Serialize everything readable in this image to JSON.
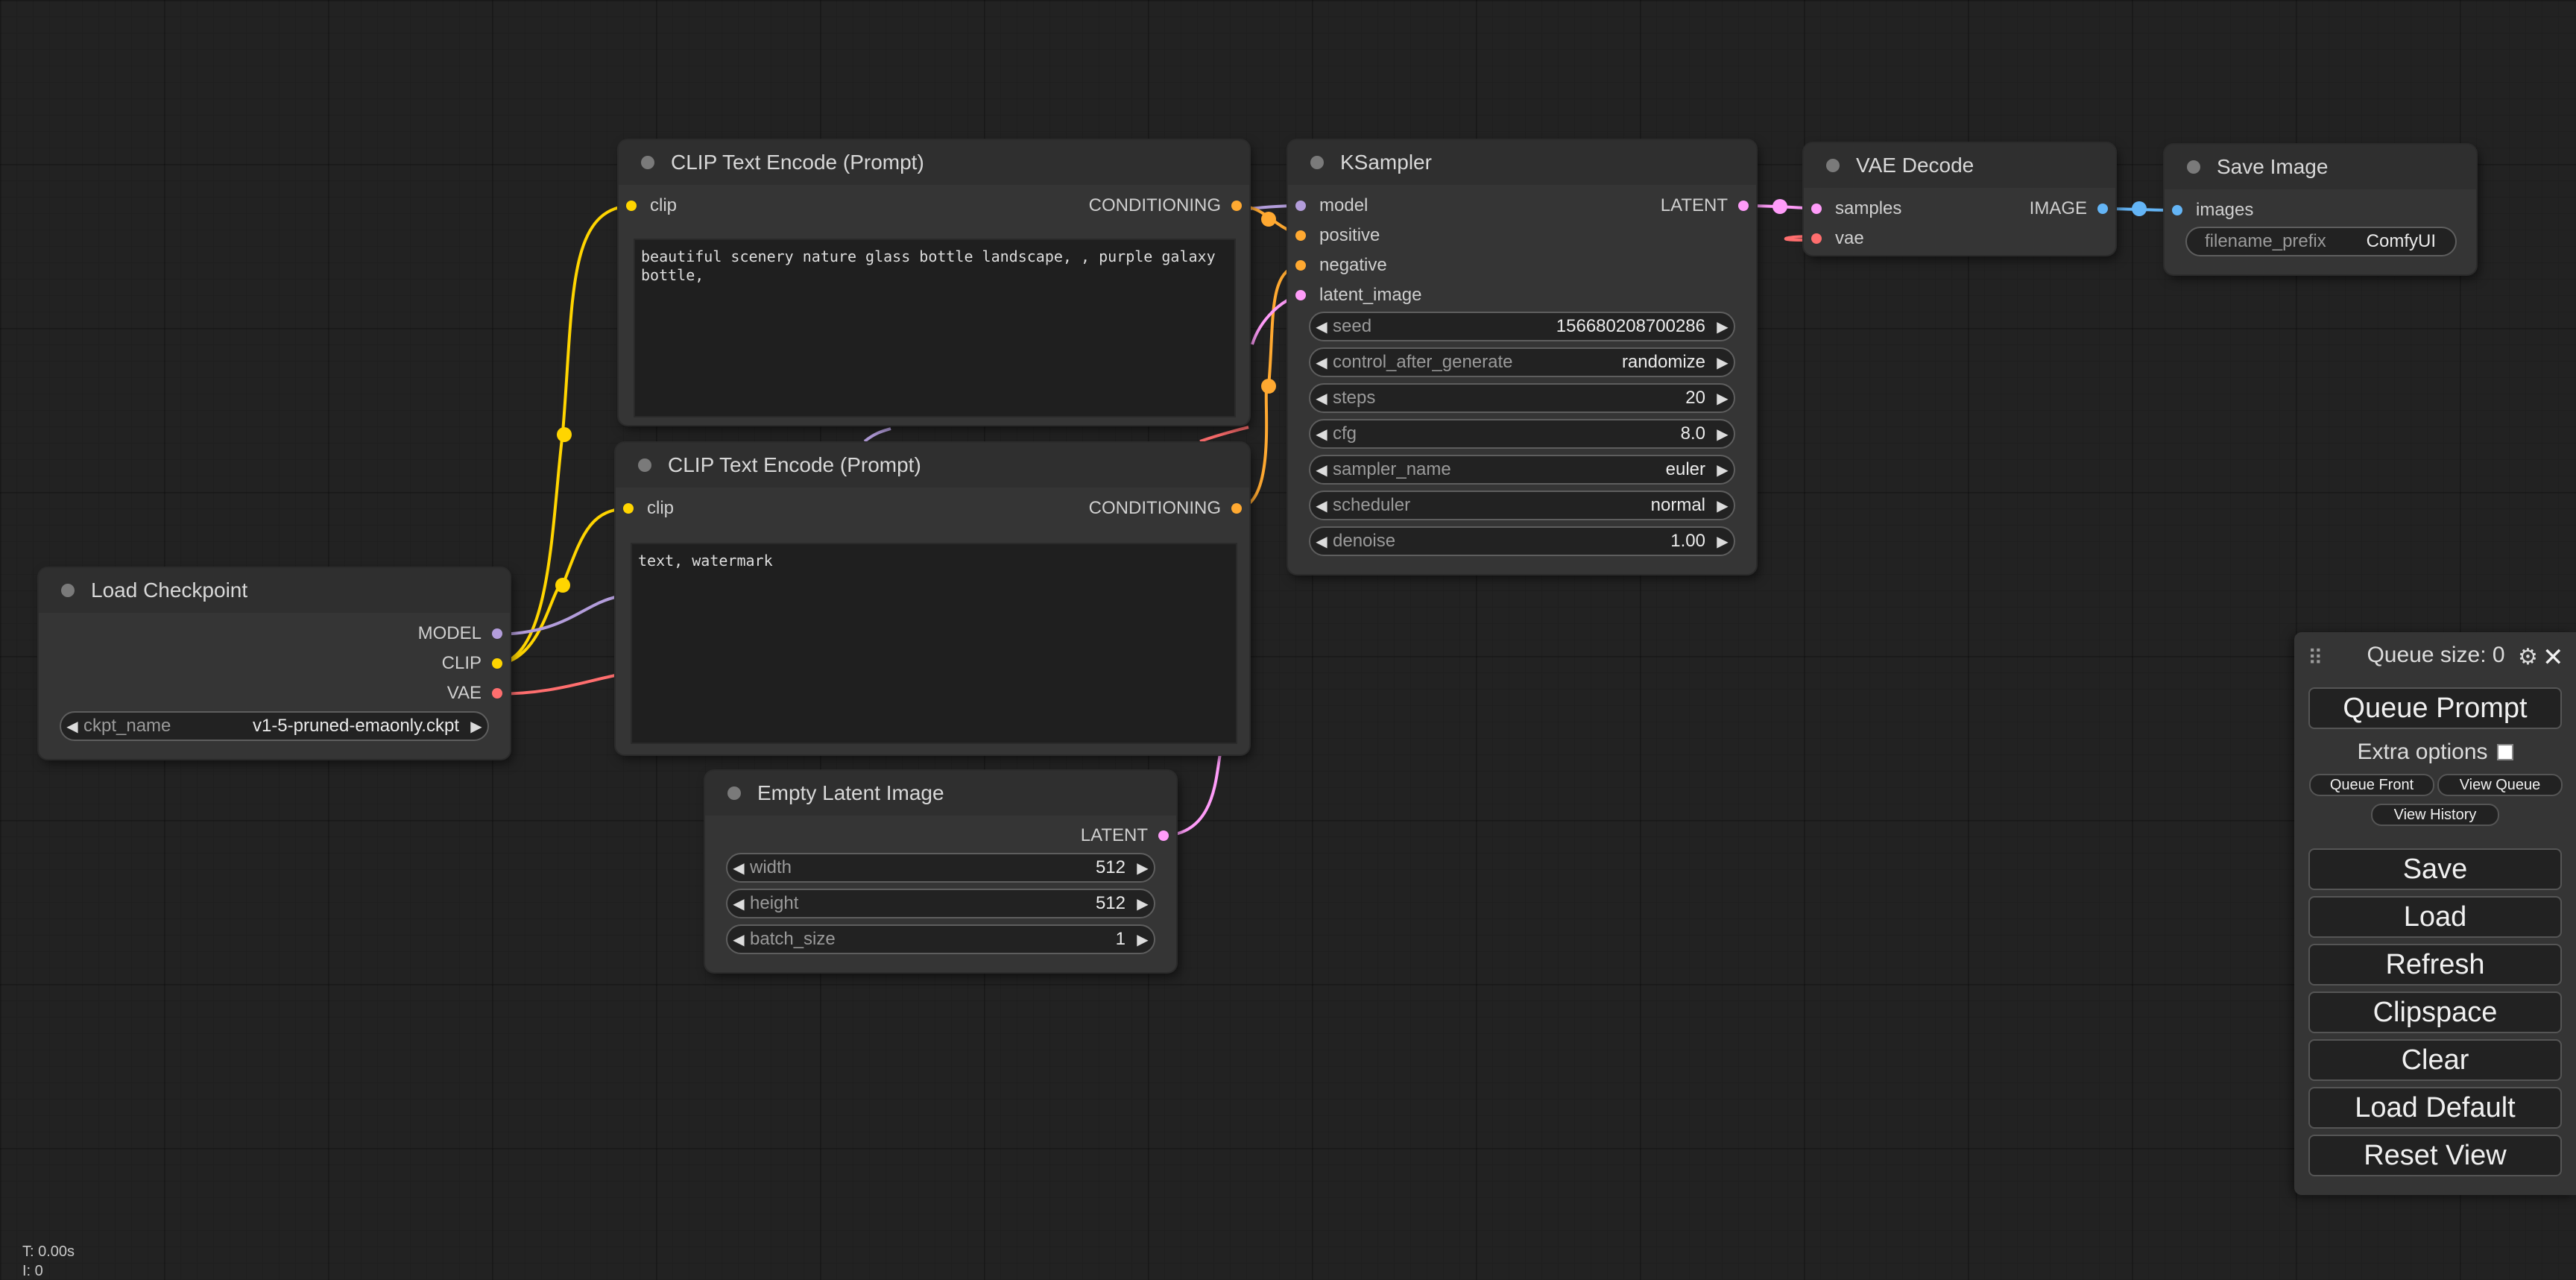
{
  "colors": {
    "model": "#b39ddb",
    "clip": "#ffd500",
    "vae": "#ff6e6e",
    "conditioning": "#ffa931",
    "latent": "#ff9cf9",
    "image": "#64b5f6"
  },
  "nodes": {
    "clip_pos": {
      "title": "CLIP Text Encode (Prompt)",
      "input": "clip",
      "output": "CONDITIONING",
      "text": "beautiful scenery nature glass bottle landscape, , purple galaxy bottle,"
    },
    "clip_neg": {
      "title": "CLIP Text Encode (Prompt)",
      "input": "clip",
      "output": "CONDITIONING",
      "text": "text, watermark"
    },
    "ksampler": {
      "title": "KSampler",
      "inputs": [
        "model",
        "positive",
        "negative",
        "latent_image"
      ],
      "output": "LATENT",
      "widgets": [
        {
          "label": "seed",
          "value": "156680208700286"
        },
        {
          "label": "control_after_generate",
          "value": "randomize"
        },
        {
          "label": "steps",
          "value": "20"
        },
        {
          "label": "cfg",
          "value": "8.0"
        },
        {
          "label": "sampler_name",
          "value": "euler"
        },
        {
          "label": "scheduler",
          "value": "normal"
        },
        {
          "label": "denoise",
          "value": "1.00"
        }
      ]
    },
    "vae_decode": {
      "title": "VAE Decode",
      "inputs": [
        "samples",
        "vae"
      ],
      "output": "IMAGE"
    },
    "save_image": {
      "title": "Save Image",
      "input": "images",
      "widget": {
        "label": "filename_prefix",
        "value": "ComfyUI"
      }
    },
    "load_checkpoint": {
      "title": "Load Checkpoint",
      "outputs": [
        "MODEL",
        "CLIP",
        "VAE"
      ],
      "widget": {
        "label": "ckpt_name",
        "value": "v1-5-pruned-emaonly.ckpt"
      }
    },
    "empty_latent": {
      "title": "Empty Latent Image",
      "output": "LATENT",
      "widgets": [
        {
          "label": "width",
          "value": "512"
        },
        {
          "label": "height",
          "value": "512"
        },
        {
          "label": "batch_size",
          "value": "1"
        }
      ]
    }
  },
  "panel": {
    "queue_size": "Queue size: 0",
    "queue_prompt": "Queue Prompt",
    "extra_options": "Extra options",
    "queue_front": "Queue Front",
    "view_queue": "View Queue",
    "view_history": "View History",
    "save": "Save",
    "load": "Load",
    "refresh": "Refresh",
    "clipspace": "Clipspace",
    "clear": "Clear",
    "load_default": "Load Default",
    "reset_view": "Reset View"
  },
  "stats": {
    "time": "T: 0.00s",
    "index": "I: 0"
  }
}
